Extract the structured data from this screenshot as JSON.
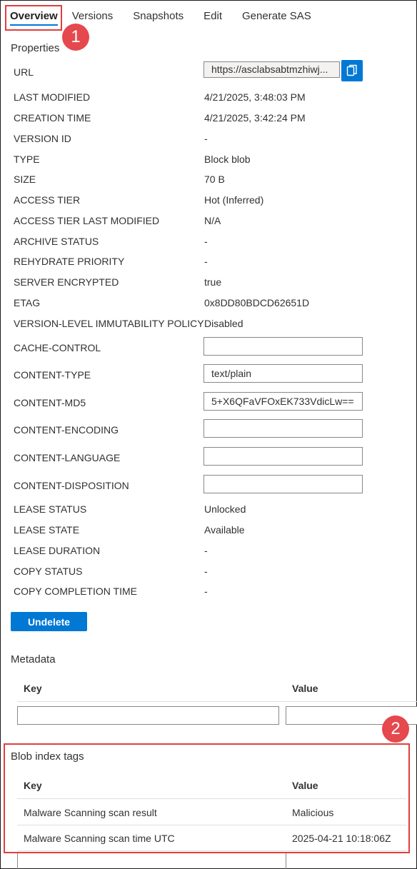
{
  "tabs": [
    "Overview",
    "Versions",
    "Snapshots",
    "Edit",
    "Generate SAS"
  ],
  "annotations": {
    "one": "1",
    "two": "2"
  },
  "properties": {
    "title": "Properties",
    "url_label": "URL",
    "url_value": "https://asclabsabtmzhiwj...",
    "rows": [
      {
        "label": "LAST MODIFIED",
        "value": "4/21/2025, 3:48:03 PM"
      },
      {
        "label": "CREATION TIME",
        "value": "4/21/2025, 3:42:24 PM"
      },
      {
        "label": "VERSION ID",
        "value": "-"
      },
      {
        "label": "TYPE",
        "value": "Block blob"
      },
      {
        "label": "SIZE",
        "value": "70 B"
      },
      {
        "label": "ACCESS TIER",
        "value": "Hot (Inferred)"
      },
      {
        "label": "ACCESS TIER LAST MODIFIED",
        "value": "N/A"
      },
      {
        "label": "ARCHIVE STATUS",
        "value": "-"
      },
      {
        "label": "REHYDRATE PRIORITY",
        "value": "-"
      },
      {
        "label": "SERVER ENCRYPTED",
        "value": "true"
      },
      {
        "label": "ETAG",
        "value": "0x8DD80BDCD62651D"
      },
      {
        "label": "VERSION-LEVEL IMMUTABILITY POLICY",
        "value": "Disabled"
      }
    ],
    "inputs": [
      {
        "label": "CACHE-CONTROL",
        "value": ""
      },
      {
        "label": "CONTENT-TYPE",
        "value": "text/plain"
      },
      {
        "label": "CONTENT-MD5",
        "value": "5+X6QFaVFOxEK733VdicLw=="
      },
      {
        "label": "CONTENT-ENCODING",
        "value": ""
      },
      {
        "label": "CONTENT-LANGUAGE",
        "value": ""
      },
      {
        "label": "CONTENT-DISPOSITION",
        "value": ""
      }
    ],
    "rows2": [
      {
        "label": "LEASE STATUS",
        "value": "Unlocked"
      },
      {
        "label": "LEASE STATE",
        "value": "Available"
      },
      {
        "label": "LEASE DURATION",
        "value": "-"
      },
      {
        "label": "COPY STATUS",
        "value": "-"
      },
      {
        "label": "COPY COMPLETION TIME",
        "value": "-"
      }
    ]
  },
  "undelete_label": "Undelete",
  "metadata": {
    "title": "Metadata",
    "key_header": "Key",
    "value_header": "Value"
  },
  "blob_index_tags": {
    "title": "Blob index tags",
    "key_header": "Key",
    "value_header": "Value",
    "rows": [
      {
        "key": "Malware Scanning scan result",
        "value": "Malicious"
      },
      {
        "key": "Malware Scanning scan time UTC",
        "value": "2025-04-21 10:18:06Z"
      }
    ]
  },
  "colors": {
    "accent": "#0078d4",
    "annotation": "#e03e3e"
  },
  "icons": {
    "copy": "copy-icon"
  }
}
